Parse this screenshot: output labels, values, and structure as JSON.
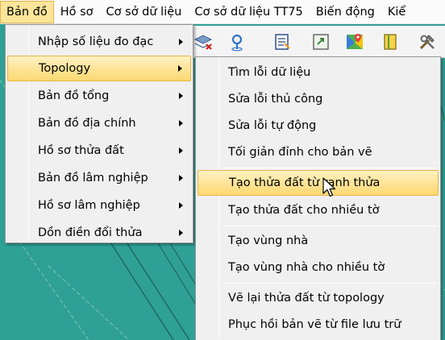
{
  "menubar": {
    "items": [
      "Bản đồ",
      "Hồ sơ",
      "Cơ sở dữ liệu",
      "Cơ sở dữ liệu TT75",
      "Biến động",
      "Kiể"
    ]
  },
  "toolbar": {
    "icons": [
      "layers-delete-icon",
      "pin-icon",
      "document-icon",
      "export-icon",
      "google-maps-icon",
      "book-icon",
      "tools-icon"
    ]
  },
  "main_menu": {
    "items": [
      {
        "label": "Nhập số liệu đo đạc"
      },
      {
        "label": "Topology"
      },
      {
        "label": "Bản đồ tổng"
      },
      {
        "label": "Bản đồ địa chính"
      },
      {
        "label": "Hồ sơ thửa đất"
      },
      {
        "label": "Bản đồ lâm nghiệp"
      },
      {
        "label": "Hồ sơ lâm nghiệp"
      },
      {
        "label": "Dồn điền đổi thửa"
      }
    ]
  },
  "sub_menu": {
    "items": [
      {
        "label": "Tìm lỗi dữ liệu"
      },
      {
        "label": "Sửa lỗi thủ công"
      },
      {
        "label": "Sửa lỗi tự động"
      },
      {
        "label": "Tối giản đỉnh cho bản vẽ"
      },
      {
        "label": "Tạo thửa đất từ ranh thửa"
      },
      {
        "label": "Tạo thửa đất cho nhiều tờ"
      },
      {
        "label": "Tạo vùng nhà"
      },
      {
        "label": "Tạo vùng nhà cho nhiều tờ"
      },
      {
        "label": "Vẽ lại thửa đất từ topology"
      },
      {
        "label": "Phục hồi bản vẽ từ file lưu trữ"
      }
    ]
  },
  "colors": {
    "highlight": "#fbd870",
    "map": "#2fa095"
  }
}
